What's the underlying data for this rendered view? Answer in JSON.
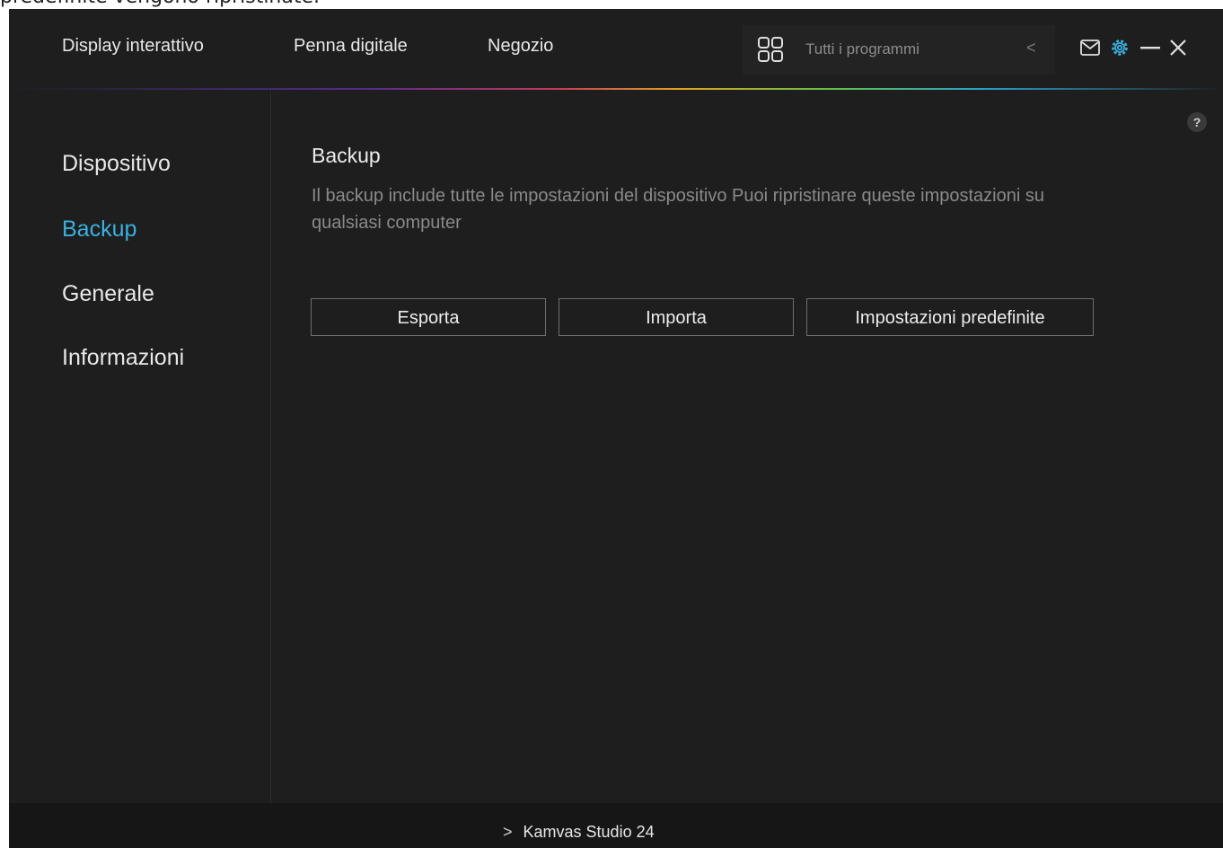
{
  "document": {
    "partial_text": "predefinite vengono ripristinate."
  },
  "header": {
    "nav": [
      "Display interattivo",
      "Penna digitale",
      "Negozio"
    ],
    "program_selector": {
      "label": "Tutti i programmi",
      "icon": "grid-icon",
      "chevron": "<"
    },
    "icons": [
      "mail-icon",
      "gear-icon",
      "minimize-icon",
      "close-icon"
    ],
    "accent_color": "#3ab0e0"
  },
  "sidebar": {
    "items": [
      {
        "label": "Dispositivo",
        "active": false
      },
      {
        "label": "Backup",
        "active": true
      },
      {
        "label": "Generale",
        "active": false
      },
      {
        "label": "Informazioni",
        "active": false
      }
    ]
  },
  "main": {
    "help": "?",
    "title": "Backup",
    "description": "Il backup include tutte le impostazioni del dispositivo Puoi ripristinare queste impostazioni su qualsiasi computer",
    "buttons": {
      "export": "Esporta",
      "import": "Importa",
      "defaults": "Impostazioni predefinite"
    }
  },
  "footer": {
    "device_chevron": ">",
    "device": "Kamvas Studio 24"
  }
}
